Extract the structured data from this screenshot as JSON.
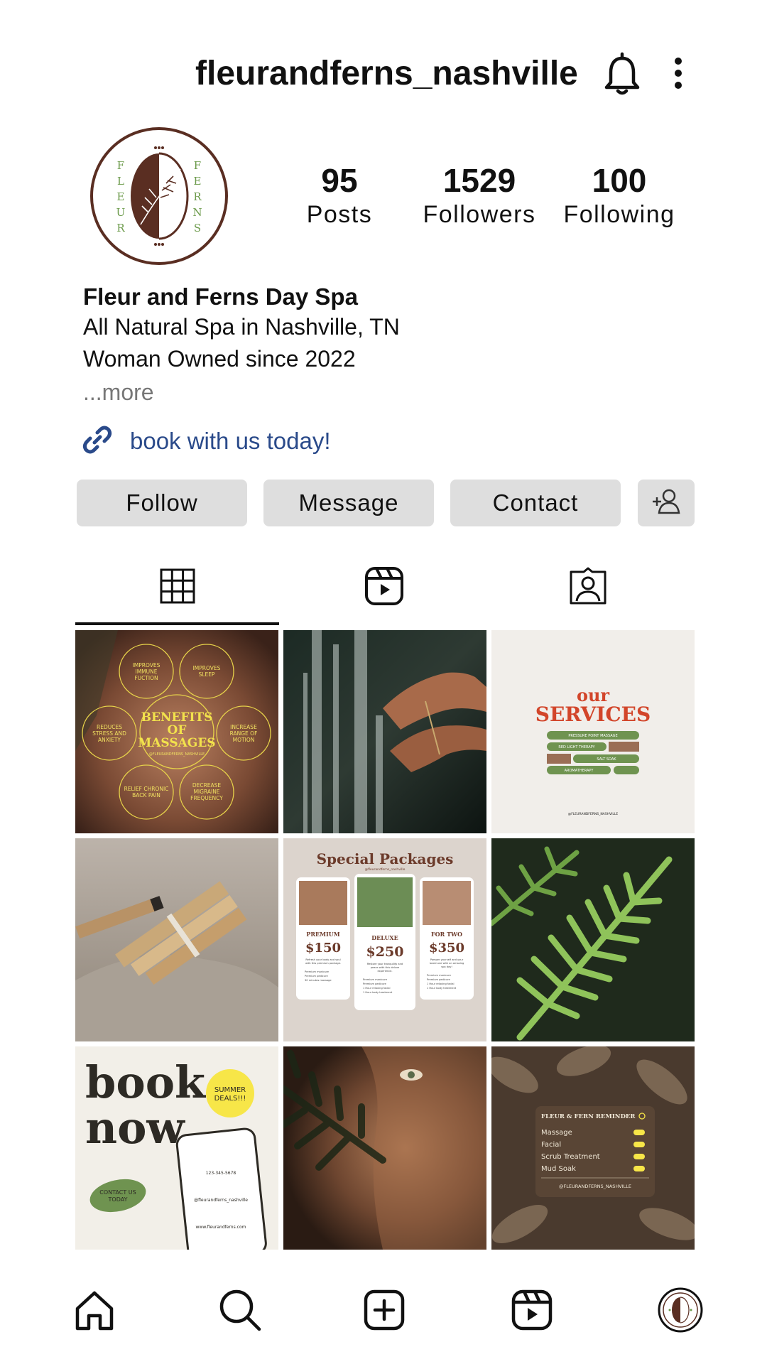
{
  "header": {
    "username": "fleurandferns_nashville",
    "bell_icon": "bell-icon",
    "more_icon": "more-vertical-icon"
  },
  "profile": {
    "logo_left_text": "FLEUR",
    "logo_right_text": "FERNS",
    "stats": [
      {
        "value": "95",
        "label": "Posts"
      },
      {
        "value": "1529",
        "label": "Followers"
      },
      {
        "value": "100",
        "label": "Following"
      }
    ],
    "display_name": "Fleur and Ferns Day Spa",
    "bio_lines": [
      "All Natural Spa in Nashville, TN",
      "Woman Owned since 2022"
    ],
    "more_label": "...more",
    "link_text": "book with us today!",
    "link_icon": "link-icon"
  },
  "actions": {
    "follow": "Follow",
    "message": "Message",
    "contact": "Contact",
    "add_user_icon": "add-user-icon"
  },
  "tabs": [
    {
      "name": "grid",
      "icon": "grid-icon",
      "active": true
    },
    {
      "name": "reels",
      "icon": "reels-icon",
      "active": false
    },
    {
      "name": "tagged",
      "icon": "tagged-icon",
      "active": false
    }
  ],
  "posts": {
    "p1": {
      "title_lines": [
        "BENEFITS",
        "OF",
        "MASSAGES"
      ],
      "handle": "@FLEURANDFERNS_NASHVILLE",
      "bubbles": [
        [
          "IMPROVES",
          "IMMUNE",
          "FUCTION"
        ],
        [
          "IMPROVES",
          "SLEEP"
        ],
        [
          "REDUCES",
          "STRESS AND",
          "ANXIETY"
        ],
        [
          "INCREASE",
          "RANGE OF",
          "MOTION"
        ],
        [
          "RELIEF CHRONIC",
          "BACK PAIN"
        ],
        [
          "DECREASE",
          "MIGRAINE",
          "FREQUENCY"
        ]
      ]
    },
    "p3": {
      "title_top": "our",
      "title_main": "SERVICES",
      "pills": [
        "PRESSURE POINT MASSAGE",
        "RED LIGHT THERAPY",
        "SALT SOAK",
        "AROMATHERAPY"
      ],
      "handle": "@FLEURANDFERNS_NASHVILLE"
    },
    "p5": {
      "title": "Special Packages",
      "handle": "@fleurandferns_nashville",
      "packages": [
        {
          "name": "PREMIUM",
          "price": "$150",
          "desc": [
            "Refresh your body and soul",
            "with this premium package."
          ],
          "items": [
            "Premium manicure",
            "Premium pedicure",
            "30 minutes massage"
          ]
        },
        {
          "name": "DELUXE",
          "price": "$250",
          "desc": [
            "Restore your tranquility and",
            "peace with this deluxe",
            "experience."
          ],
          "items": [
            "Premium manicure",
            "Premium pedicure",
            "1 Hour relaxing facial",
            "1 Hour body treatment"
          ]
        },
        {
          "name": "FOR TWO",
          "price": "$350",
          "desc": [
            "Pamper yourself and your",
            "loved one with an amazing",
            "spa day!"
          ],
          "items": [
            "Premium manicure",
            "Premium pedicure",
            "1 Hour relaxing facial",
            "1 Hour body treatment"
          ]
        }
      ]
    },
    "p7": {
      "title_lines": [
        "book",
        "now"
      ],
      "badge_lines": [
        "SUMMER",
        "DEALS!!!"
      ],
      "cta_lines": [
        "CONTACT US",
        "TODAY"
      ],
      "phone": "123-345-5678",
      "handle": "@fleurandferns_nashville",
      "website": "www.fleurandferns.com"
    },
    "p9": {
      "title": "FLEUR & FERN REMINDER",
      "items": [
        "Massage",
        "Facial",
        "Scrub Treatment",
        "Mud Soak"
      ],
      "handle": "@FLEURANDFERNS_NASHVILLE"
    }
  },
  "nav": [
    "home-icon",
    "search-icon",
    "create-icon",
    "reels-icon",
    "profile-avatar"
  ]
}
